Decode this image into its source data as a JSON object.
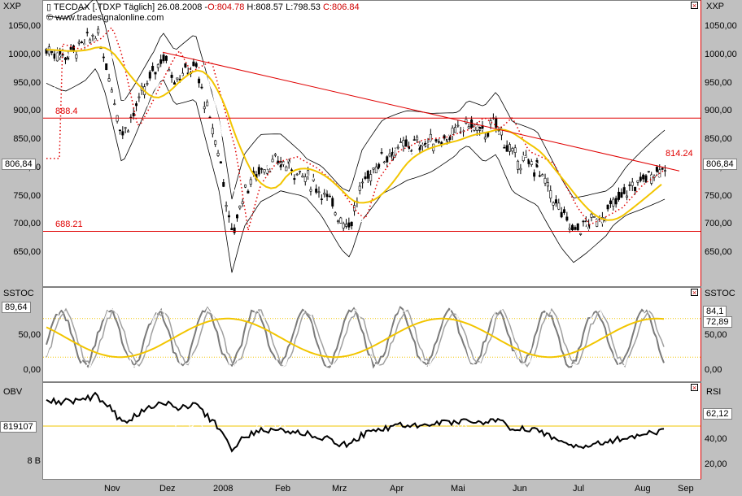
{
  "header": {
    "symbol_left": "XXP",
    "symbol_right": "XXP",
    "title": "TECDAX [.TDXP  Täglich] 26.08.2008",
    "open": "O:804.78",
    "hl": "H:808.57 L:798.53",
    "close": "C:806.84",
    "watermark": "© www.tradesignalonline.com"
  },
  "price_pane": {
    "y_ticks": [
      "1050,00",
      "1000,00",
      "950,00",
      "900,00",
      "850,00",
      "800,00",
      "750,00",
      "700,00",
      "650,00"
    ],
    "y_tick_values": [
      1050,
      1000,
      950,
      900,
      850,
      800,
      750,
      700,
      650
    ],
    "last_left": "806,84",
    "last_right": "806,84",
    "level_high": "888.4",
    "level_low": "688.21",
    "trend_end_label": "814.24"
  },
  "stoc_pane": {
    "name_left": "SSTOC",
    "name_right": "SSTOC",
    "y_ticks": [
      "50,00",
      "0,00"
    ],
    "y_ticks_right": [
      "50,00",
      "0,00"
    ],
    "value_left": "89,64",
    "value_right_1": "84,1",
    "value_right_2": "72,89"
  },
  "obv_pane": {
    "name_left": "OBV",
    "name_right": "RSI",
    "value_left": "819107",
    "tick_left": "8 B",
    "value_right": "62,12",
    "y_ticks_right": [
      "40,00",
      "20,00"
    ]
  },
  "x_axis": [
    "Nov",
    "Dez",
    "2008",
    "Feb",
    "Mrz",
    "Apr",
    "Mai",
    "Jun",
    "Jul",
    "Aug",
    "Sep"
  ],
  "chart_data": {
    "type": "line",
    "title": "TECDAX [.TDXP  Täglich] 26.08.2008",
    "x": [
      "Nov",
      "Dez",
      "2008",
      "Feb",
      "Mrz",
      "Apr",
      "Mai",
      "Jun",
      "Jul",
      "Aug",
      "Sep"
    ],
    "ylim": [
      630,
      1070
    ],
    "series": [
      {
        "name": "TECDAX",
        "values": [
          1010,
          960,
          980,
          850,
          700,
          850,
          880,
          850,
          700,
          760,
          807
        ]
      }
    ],
    "horizontal_lines": [
      888.4,
      688.21
    ],
    "trendline": [
      1005,
      814.24
    ],
    "colors": {
      "price": "#000000",
      "ma": "#f2c500",
      "lines": "#e00000",
      "bands": "#000000",
      "close_line": "#ffffff"
    }
  }
}
